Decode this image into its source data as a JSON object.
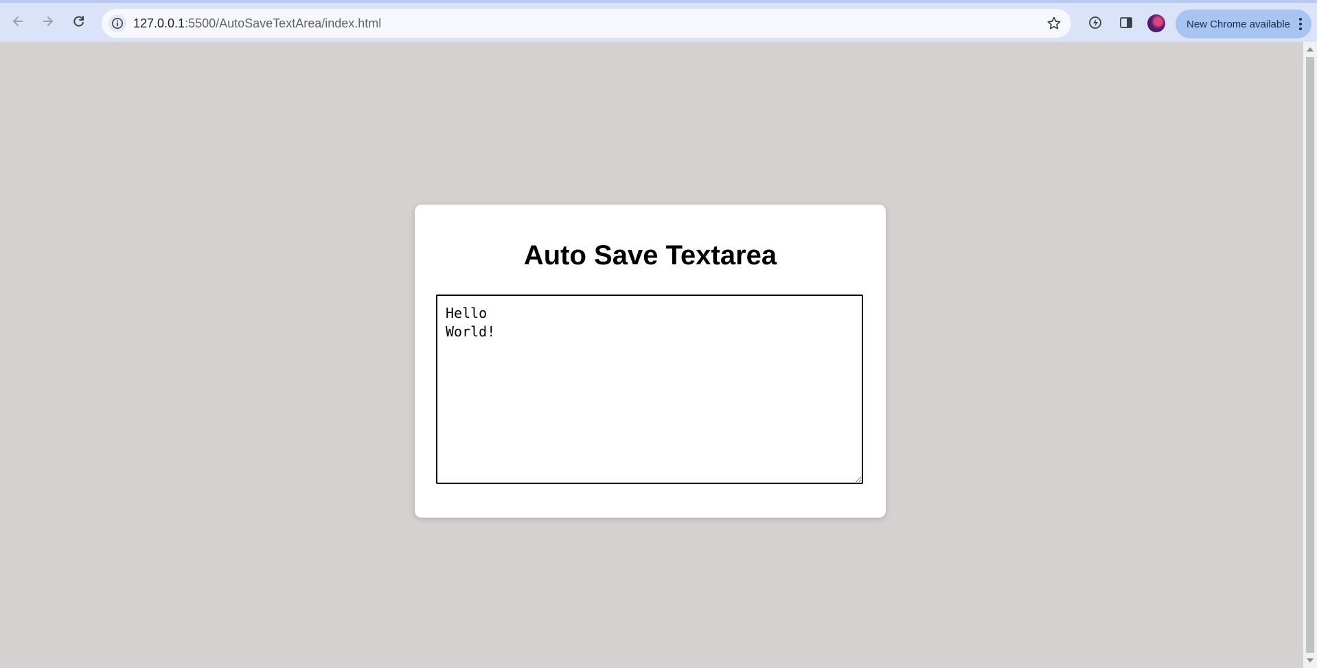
{
  "browser": {
    "url_host": "127.0.0.1",
    "url_path": ":5500/AutoSaveTextArea/index.html",
    "update_label": "New Chrome available"
  },
  "page": {
    "title": "Auto Save Textarea",
    "textarea_value": "Hello\nWorld!"
  },
  "colors": {
    "page_background": "#d5d1d1",
    "toolbar_background": "#dae3f8",
    "update_button": "#a8c4f3"
  }
}
